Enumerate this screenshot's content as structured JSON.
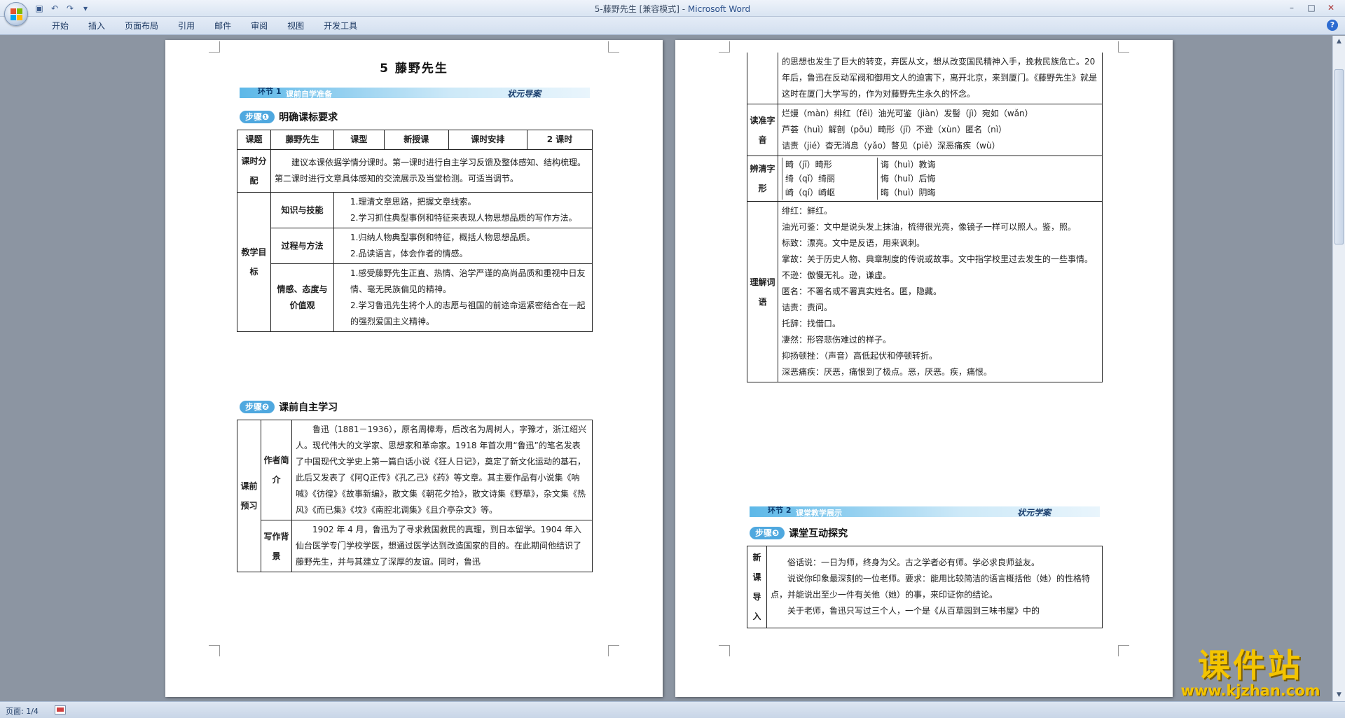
{
  "window": {
    "title_doc": "5-藤野先生 [兼容模式] - ",
    "title_app": "Microsoft Word",
    "minimize": "–",
    "maximize": "□",
    "close": "✕"
  },
  "ribbon": {
    "tabs": [
      "开始",
      "插入",
      "页面布局",
      "引用",
      "邮件",
      "审阅",
      "视图",
      "开发工具"
    ],
    "help": "?"
  },
  "status": {
    "page": "页面: 1/4"
  },
  "colors": {
    "accent": "#4fa8df",
    "watermark": "#f3c400"
  },
  "page1": {
    "title": "5  藤野先生",
    "banner1": {
      "num": "环节 1",
      "label": "课前自学准备",
      "right": "状元导案"
    },
    "step1": {
      "pill": "步骤❶",
      "text": "明确课标要求"
    },
    "t1": {
      "r0": [
        "课题",
        "藤野先生",
        "课型",
        "新授课",
        "课时安排",
        "2 课时"
      ],
      "r1_head": "课时分配",
      "r1_text": "建议本课依据学情分课时。第一课时进行自主学习反馈及整体感知、结构梳理。第二课时进行文章具体感知的交流展示及当堂检测。可适当调节。",
      "goal_head": "教学目标",
      "g1_head": "知识与技能",
      "g1_a": "1.理清文章思路，把握文章线索。",
      "g1_b": "2.学习抓住典型事例和特征来表现人物思想品质的写作方法。",
      "g2_head": "过程与方法",
      "g2_a": "1.归纳人物典型事例和特征，概括人物思想品质。",
      "g2_b": "2.品读语言，体会作者的情感。",
      "g3_head": "情感、态度与价值观",
      "g3_a": "1.感受藤野先生正直、热情、治学严谨的高尚品质和重视中日友情、毫无民族偏见的精神。",
      "g3_b": "2.学习鲁迅先生将个人的志愿与祖国的前途命运紧密结合在一起的强烈爱国主义精神。"
    },
    "step2": {
      "pill": "步骤❷",
      "text": "课前自主学习"
    },
    "t2": {
      "outer_head": "课前预习",
      "a_head": "作者简介",
      "a_text": "鲁迅（1881－1936），原名周樟寿，后改名为周树人，字豫才，浙江绍兴人。现代伟大的文学家、思想家和革命家。1918 年首次用“鲁迅”的笔名发表了中国现代文学史上第一篇白话小说《狂人日记》，奠定了新文化运动的基石，此后又发表了《阿Q正传》《孔乙己》《药》等文章。其主要作品有小说集《呐喊》《彷徨》《故事新编》，散文集《朝花夕拾》，散文诗集《野草》，杂文集《热风》《而已集》《坟》《南腔北调集》《且介亭杂文》等。",
      "b_head": "写作背景",
      "b_text": "1902 年 4 月，鲁迅为了寻求救国救民的真理，到日本留学。1904 年入仙台医学专门学校学医，想通过医学达到改造国家的目的。在此期间他结识了藤野先生，并与其建立了深厚的友谊。同时，鲁迅"
    }
  },
  "page2": {
    "cont": "的思想也发生了巨大的转变，弃医从文，想从改变国民精神入手，挽救民族危亡。20 年后，鲁迅在反动军阀和御用文人的迫害下，离开北京，来到厦门。《藤野先生》就是这时在厦门大学写的，作为对藤野先生永久的怀念。",
    "pron_head": "读准字音",
    "pron_1": "烂熳（màn）绯红（fēi）油光可鉴（jiàn）发髻（jì）宛如（wǎn）",
    "pron_2": "芦荟（huì）解剖（pōu）畸形（jī）不逊（xùn）匿名（nì）",
    "pron_3": "诘责（jié）杳无消息（yǎo）瞥见（piē）深恶痛疾（wù）",
    "dist_head": "辨清字形",
    "dist_l1": "畸（jī）畸形",
    "dist_l2": "绮（qǐ）绮丽",
    "dist_l3": "崎（qí）崎岖",
    "dist_r1": "诲（huì）教诲",
    "dist_r2": "悔（huǐ）后悔",
    "dist_r3": "晦（huì）阴晦",
    "vocab_head": "理解词语",
    "vocab": [
      "绯红：鲜红。",
      "油光可鉴：文中是说头发上抹油，梳得很光亮，像镜子一样可以照人。鉴，照。",
      "标致：漂亮。文中是反语，用来讽刺。",
      "掌故：关于历史人物、典章制度的传说或故事。文中指学校里过去发生的一些事情。",
      "不逊：傲慢无礼。逊，谦虚。",
      "匿名：不署名或不署真实姓名。匿，隐藏。",
      "诘责：责问。",
      "托辞：找借口。",
      "凄然：形容悲伤难过的样子。",
      "抑扬顿挫：（声音）高低起伏和停顿转折。",
      "深恶痛疾：厌恶，痛恨到了极点。恶，厌恶。疾，痛恨。"
    ],
    "banner2": {
      "num": "环节 2",
      "label": "课堂教学展示",
      "right": "状元学案"
    },
    "step3": {
      "pill": "步骤❸",
      "text": "课堂互动探究"
    },
    "intro_head": "新课导入",
    "intro_1": "俗话说：一日为师，终身为父。古之学者必有师。学必求良师益友。",
    "intro_2": "说说你印象最深刻的一位老师。要求：能用比较简洁的语言概括他（她）的性格特点，并能说出至少一件有关他（她）的事，来印证你的结论。",
    "intro_3": "关于老师，鲁迅只写过三个人，一个是《从百草园到三味书屋》中的"
  },
  "watermark": {
    "cn": "课件站",
    "url": "www.kjzhan.com"
  }
}
